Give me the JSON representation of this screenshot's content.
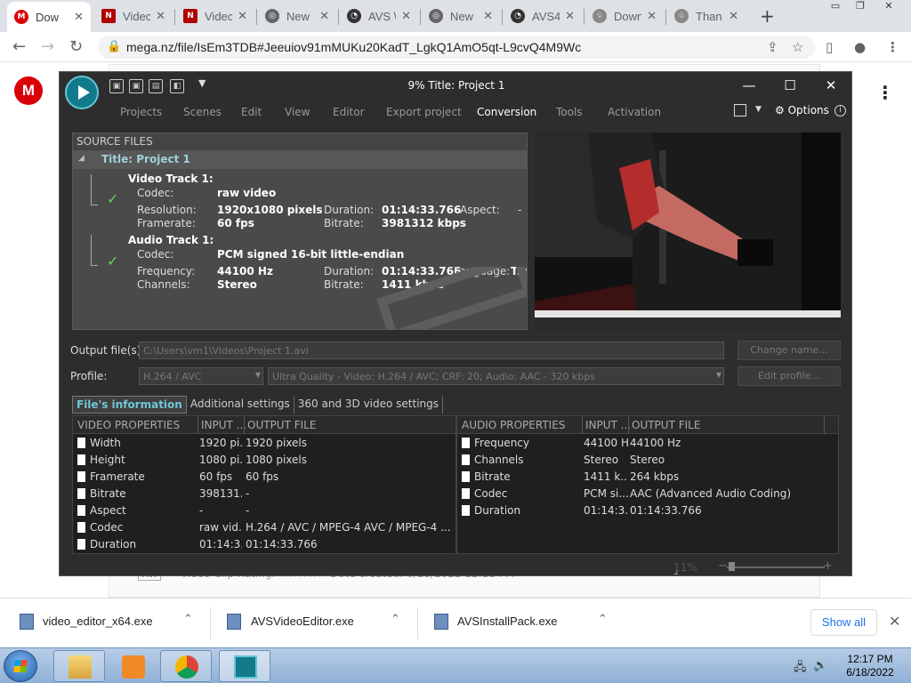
{
  "browser": {
    "tabs": [
      {
        "title": "Dow",
        "favicon": "mega-icon",
        "color": "#d90007",
        "glyph": "M"
      },
      {
        "title": "Videc",
        "favicon": "nch-icon",
        "color": "#b00000",
        "glyph": "N"
      },
      {
        "title": "Videc",
        "favicon": "nch-icon",
        "color": "#b00000",
        "glyph": "N"
      },
      {
        "title": "New",
        "favicon": "chrome-icon",
        "color": "#555555",
        "glyph": "◎"
      },
      {
        "title": "AVS \\",
        "favicon": "avs-icon",
        "color": "#333333",
        "glyph": "◔"
      },
      {
        "title": "New",
        "favicon": "chrome-icon",
        "color": "#555555",
        "glyph": "◎"
      },
      {
        "title": "AVS4",
        "favicon": "avs-icon",
        "color": "#333333",
        "glyph": "◔"
      },
      {
        "title": "Down",
        "favicon": "download-site-icon",
        "color": "#777777",
        "glyph": "♧"
      },
      {
        "title": "Than",
        "favicon": "download-site-icon",
        "color": "#777777",
        "glyph": "♧"
      }
    ],
    "new_tab": "+",
    "url": "mega.nz/file/IsEm3TDB#Jeeuiov91mMUKu20KadT_LgkQ1AmO5qt-L9cvQ4M9Wc"
  },
  "mega": {
    "logo": "M",
    "file_type": "AVI",
    "row_text": "Video Clip   Rating: ☆☆☆☆☆         Date created: 6/18/2022 12:11 PM"
  },
  "avs": {
    "title": "9% Title: Project 1",
    "menu": [
      "Projects",
      "Scenes",
      "Edit",
      "View",
      "Editor",
      "Export project",
      "Conversion",
      "Tools",
      "Activation"
    ],
    "active_menu": "Conversion",
    "options": "Options",
    "source_header": "SOURCE FILES",
    "project_title": "Title: Project 1",
    "video_track": {
      "heading": "Video Track 1:",
      "codec_label": "Codec:",
      "codec": "raw video",
      "resolution_label": "Resolution:",
      "resolution": "1920x1080 pixels",
      "duration_label": "Duration:",
      "duration": "01:14:33.766",
      "aspect_label": "Aspect:",
      "aspect": "-",
      "framerate_label": "Framerate:",
      "framerate": "60 fps",
      "bitrate_label": "Bitrate:",
      "bitrate": "3981312 kbps"
    },
    "audio_track": {
      "heading": "Audio Track 1:",
      "codec_label": "Codec:",
      "codec": "PCM signed 16-bit little-endian",
      "frequency_label": "Frequency:",
      "frequency": "44100 Hz",
      "duration_label": "Duration:",
      "duration": "01:14:33.766",
      "language_label": "Language:",
      "language": "Tra",
      "channels_label": "Channels:",
      "channels": "Stereo",
      "bitrate_label": "Bitrate:",
      "bitrate": "1411 kbps"
    },
    "output_label": "Output file(s):",
    "output_path": "C:\\Users\\vm1\\Videos\\Project 1.avi",
    "change_name": "Change name...",
    "profile_label": "Profile:",
    "profile_format": "H.264 / AVC",
    "profile_preset": "Ultra Quality - Video: H.264 / AVC; CRF: 20; Audio: AAC - 320 kbps",
    "edit_profile": "Edit profile...",
    "tabs": [
      "File's information",
      "Additional settings",
      "360 and 3D video settings"
    ],
    "video_props": {
      "headers": [
        "VIDEO PROPERTIES",
        "INPUT ...",
        "OUTPUT FILE"
      ],
      "rows": [
        [
          "Width",
          "1920 pi...",
          "1920 pixels"
        ],
        [
          "Height",
          "1080 pi...",
          "1080 pixels"
        ],
        [
          "Framerate",
          "60 fps",
          "60 fps"
        ],
        [
          "Bitrate",
          "398131...",
          "-"
        ],
        [
          "Aspect",
          "-",
          "-"
        ],
        [
          "Codec",
          "raw vid...",
          "H.264 / AVC / MPEG-4 AVC / MPEG-4 ..."
        ],
        [
          "Duration",
          "01:14:3...",
          "01:14:33.766"
        ]
      ]
    },
    "audio_props": {
      "headers": [
        "AUDIO PROPERTIES",
        "INPUT ...",
        "OUTPUT FILE"
      ],
      "rows": [
        [
          "Frequency",
          "44100 Hz",
          "44100 Hz"
        ],
        [
          "Channels",
          "Stereo",
          "Stereo"
        ],
        [
          "Bitrate",
          "1411 k...",
          "264 kbps"
        ],
        [
          "Codec",
          "PCM si...",
          "AAC (Advanced Audio Coding)"
        ],
        [
          "Duration",
          "01:14:3...",
          "01:14:33.766"
        ]
      ]
    },
    "zoom": "11%"
  },
  "downloads": {
    "items": [
      {
        "name": "video_editor_x64.exe"
      },
      {
        "name": "AVSVideoEditor.exe"
      },
      {
        "name": "AVSInstallPack.exe"
      }
    ],
    "show_all": "Show all"
  },
  "taskbar": {
    "time": "12:17 PM",
    "date": "6/18/2022"
  }
}
